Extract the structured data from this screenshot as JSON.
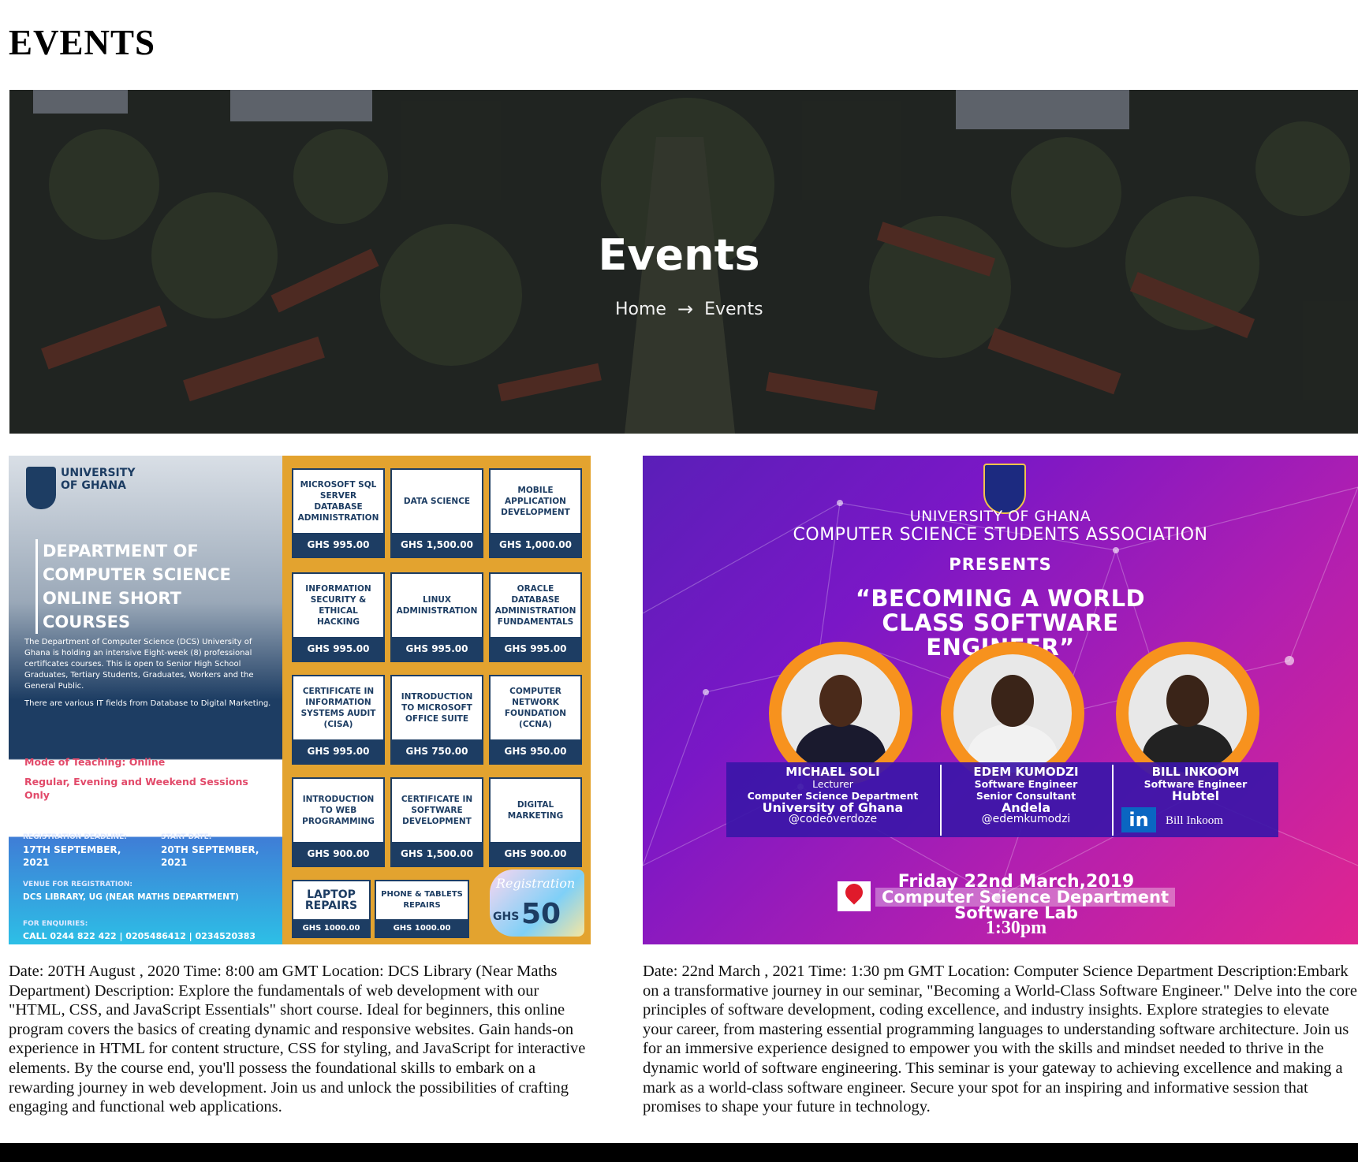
{
  "page": {
    "heading": "EVENTS"
  },
  "hero": {
    "title": "Events",
    "breadcrumb": {
      "home": "Home",
      "current": "Events"
    }
  },
  "events": [
    {
      "description": "Date: 20TH August , 2020 Time: 8:00 am GMT Location: DCS Library (Near Maths Department) Description: Explore the fundamentals of web development with our \"HTML, CSS, and JavaScript Essentials\" short course. Ideal for beginners, this online program covers the basics of creating dynamic and responsive websites. Gain hands-on experience in HTML for content structure, CSS for styling, and JavaScript for interactive elements. By the course end, you'll possess the foundational skills to embark on a rewarding journey in web development. Join us and unlock the possibilities of crafting engaging and functional web applications.",
      "flyer": {
        "uni": "UNIVERSITY OF GHANA",
        "dept_title": "DEPARTMENT OF COMPUTER SCIENCE ONLINE SHORT COURSES",
        "dept_desc": "The Department of Computer Science (DCS) University of Ghana is holding an intensive Eight-week (8) professional certificates courses. This is open to Senior High School Graduates, Tertiary Students, Graduates, Workers and the General Public.",
        "dept_desc2": "There are various IT fields from Database to Digital Marketing.",
        "mode": "Mode of Teaching: Online",
        "sessions": "Regular, Evening and Weekend Sessions Only",
        "reg_deadline_label": "REGISTRATION DEADLINE:",
        "reg_deadline": "17TH SEPTEMBER, 2021",
        "start_label": "START DATE:",
        "start": "20TH SEPTEMBER, 2021",
        "venue_label": "VENUE FOR REGISTRATION:",
        "venue": "DCS LIBRARY, UG (NEAR MATHS DEPARTMENT)",
        "enquiries_label": "FOR ENQUIRIES:",
        "enquiries": "CALL 0244 822 422 | 0205486412 | 0234520383",
        "courses": [
          {
            "name": "MICROSOFT SQL SERVER DATABASE ADMINISTRATION",
            "price": "GHS 995.00"
          },
          {
            "name": "DATA SCIENCE",
            "price": "GHS 1,500.00"
          },
          {
            "name": "MOBILE APPLICATION DEVELOPMENT",
            "price": "GHS 1,000.00"
          },
          {
            "name": "INFORMATION SECURITY & ETHICAL HACKING",
            "price": "GHS 995.00"
          },
          {
            "name": "LINUX ADMINISTRATION",
            "price": "GHS 995.00"
          },
          {
            "name": "ORACLE DATABASE ADMINISTRATION FUNDAMENTALS",
            "price": "GHS 995.00"
          },
          {
            "name": "CERTIFICATE IN INFORMATION SYSTEMS AUDIT (CISA)",
            "price": "GHS 995.00"
          },
          {
            "name": "INTRODUCTION TO MICROSOFT OFFICE SUITE",
            "price": "GHS 750.00"
          },
          {
            "name": "COMPUTER NETWORK FOUNDATION (CCNA)",
            "price": "GHS 950.00"
          },
          {
            "name": "INTRODUCTION TO WEB PROGRAMMING",
            "price": "GHS 900.00"
          },
          {
            "name": "CERTIFICATE IN SOFTWARE DEVELOPMENT",
            "price": "GHS 1,500.00"
          },
          {
            "name": "DIGITAL MARKETING",
            "price": "GHS 900.00"
          },
          {
            "name": "LAPTOP REPAIRS",
            "price": "GHS 1000.00"
          },
          {
            "name": "PHONE & TABLETS REPAIRS",
            "price": "GHS 1000.00"
          }
        ],
        "reg_script": "Registration",
        "reg_currency": "GHS",
        "reg_amount": "50"
      }
    },
    {
      "description": "Date: 22nd March , 2021 Time: 1:30 pm GMT Location: Computer Science Department Description:Embark on a transformative journey in our seminar, \"Becoming a World-Class Software Engineer.\" Delve into the core principles of software development, coding excellence, and industry insights. Explore strategies to elevate your career, from mastering essential programming languages to understanding software architecture. Join us for an immersive experience designed to empower you with the skills and mindset needed to thrive in the dynamic world of software engineering. This seminar is your gateway to achieving excellence and making a mark as a world-class software engineer. Secure your spot for an inspiring and informative session that promises to shape your future in technology.",
      "flyer": {
        "line1": "UNIVERSITY OF GHANA",
        "line2": "COMPUTER SCIENCE STUDENTS ASSOCIATION",
        "presents": "PRESENTS",
        "title": "“BECOMING A WORLD CLASS SOFTWARE ENGINEER”",
        "speakers": [
          {
            "name": "MICHAEL SOLI",
            "role": "Lecturer",
            "org1": "Computer Science Department",
            "org2": "University of Ghana",
            "handle": "@codeoverdoze"
          },
          {
            "name": "EDEM KUMODZI",
            "role": "Software Engineer",
            "org1": "Senior Consultant",
            "org2": "Andela",
            "handle": "@edemkumodzi"
          },
          {
            "name": "BILL INKOOM",
            "role": "Software Engineer",
            "org1": "Hubtel",
            "org2": "",
            "handle": "Bill Inkoom"
          }
        ],
        "linkedin": "in",
        "date": "Friday 22nd March,2019",
        "venue": "Computer Science Department",
        "lab": "Software Lab",
        "time": "1:30pm"
      }
    }
  ]
}
